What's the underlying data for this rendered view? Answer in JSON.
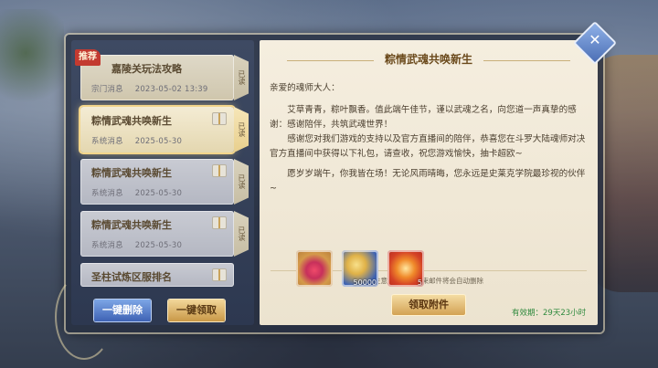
{
  "mail_list": {
    "corner_tag": "推荐",
    "items": [
      {
        "title": "嘉陵关玩法攻略",
        "category": "宗门消息",
        "date": "2023-05-02 13:39",
        "status": "已读"
      },
      {
        "title": "粽情武魂共唤新生",
        "category": "系统消息",
        "date": "2025-05-30",
        "status": "已读"
      },
      {
        "title": "粽情武魂共唤新生",
        "category": "系统消息",
        "date": "2025-05-30",
        "status": "已读"
      },
      {
        "title": "粽情武魂共唤新生",
        "category": "系统消息",
        "date": "2025-05-30",
        "status": "已读"
      },
      {
        "title": "圣柱试炼区服排名",
        "category": "",
        "date": "",
        "status": ""
      }
    ],
    "delete_button": "一键删除",
    "claim_all_button": "一键领取"
  },
  "mail_detail": {
    "title": "粽情武魂共唤新生",
    "greeting": "亲爱的魂师大人：",
    "paragraphs": [
      "艾草青青，粽叶飘香。值此端午佳节，谨以武魂之名，向您道一声真挚的感谢：感谢陪伴，共筑武魂世界！",
      "感谢您对我们游戏的支持以及官方直播间的陪伴，恭喜您在斗罗大陆魂师对决官方直播间中获得以下礼包，请查收，祝您游戏愉快，抽卡超欧~",
      "愿岁岁端午，你我皆在场！无论风雨晴晦，您永远是史莱克学院最珍视的伙伴~"
    ],
    "note": "注意：有效期结束邮件将会自动删除",
    "attachments": [
      {
        "icon": "flower-icon",
        "count": ""
      },
      {
        "icon": "gold-coin-icon",
        "count": "50000"
      },
      {
        "icon": "orb-icon",
        "count": "5"
      }
    ],
    "claim_button": "领取附件",
    "validity_label": "有效期：",
    "validity_value": "29天23小时"
  }
}
